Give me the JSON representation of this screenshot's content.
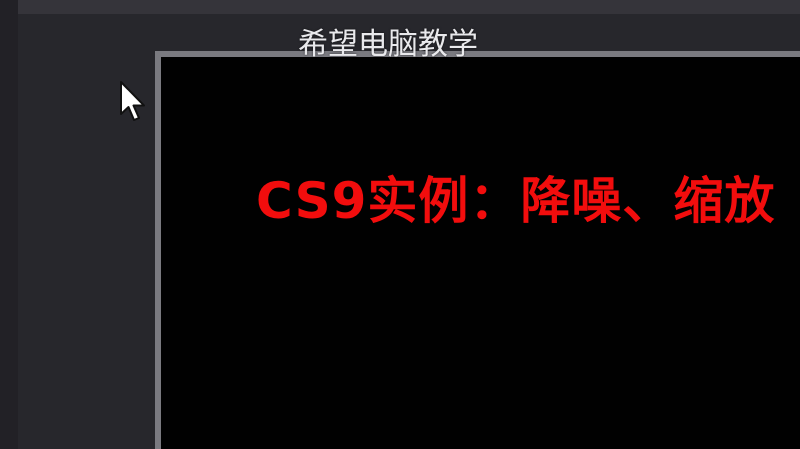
{
  "watermark": {
    "text": "希望电脑教学"
  },
  "preview": {
    "slide_title": "CS9实例：降噪、缩放"
  },
  "icons": {
    "cursor": "mouse-pointer-icon"
  },
  "colors": {
    "background": "#27272c",
    "frame_border": "#7a7a80",
    "screen": "#010101",
    "title": "#f20d0d",
    "watermark": "#e9e9ec"
  }
}
